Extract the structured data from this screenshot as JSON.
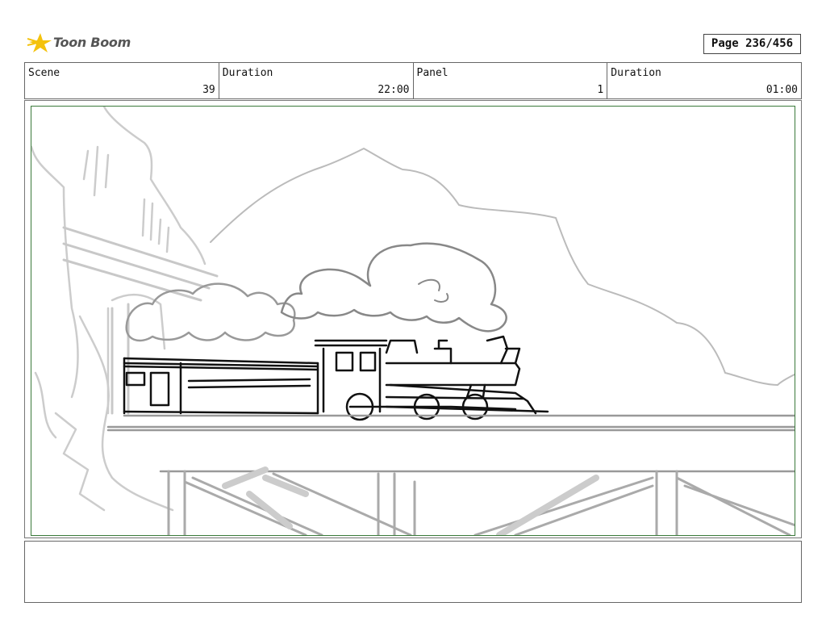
{
  "header": {
    "logo_text": "Toon Boom",
    "page_label": "Page 236/456"
  },
  "info": {
    "scene_label": "Scene",
    "scene_value": "39",
    "scene_duration_label": "Duration",
    "scene_duration_value": "22:00",
    "panel_label": "Panel",
    "panel_value": "1",
    "panel_duration_label": "Duration",
    "panel_duration_value": "01:00"
  },
  "notes": {
    "text": ""
  },
  "icons": {
    "logo": "toon-boom-star-icon"
  }
}
